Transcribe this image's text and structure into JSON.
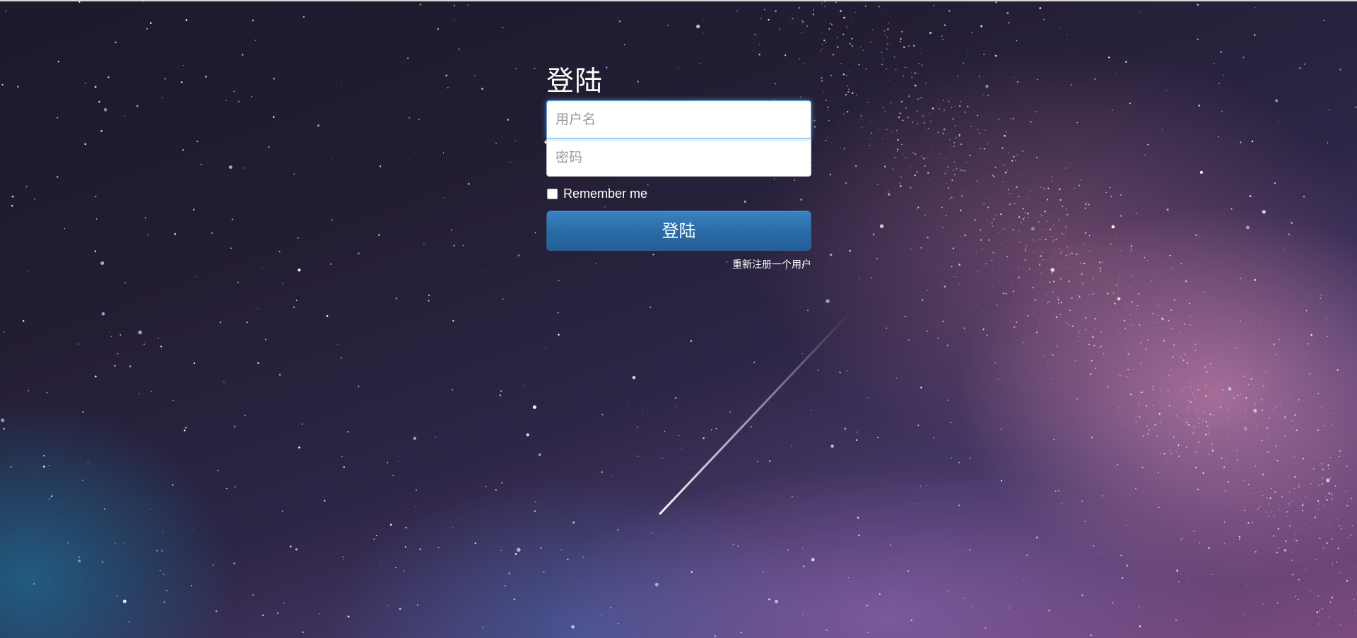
{
  "login": {
    "title": "登陆",
    "username_placeholder": "用户名",
    "password_placeholder": "密码",
    "remember_label": "Remember me",
    "remember_checked": false,
    "submit_label": "登陆",
    "register_link": "重新注册一个用户"
  },
  "colors": {
    "button": "#2a6aa4",
    "focus_border": "#66afe9",
    "text_light": "#ffffff"
  }
}
